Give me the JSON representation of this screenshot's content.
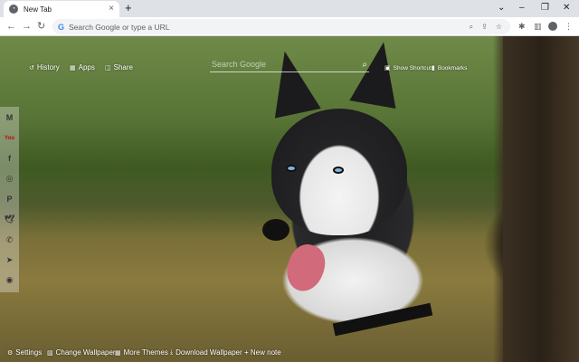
{
  "browser": {
    "tab_title": "New Tab",
    "tab_close": "×",
    "new_tab": "+",
    "omnibox_placeholder": "Search Google or type a URL",
    "window_controls": {
      "minimize": "–",
      "restore": "❐",
      "close": "✕",
      "menu": "⌄"
    }
  },
  "overlay": {
    "history_label": "History",
    "apps_label": "Apps",
    "share_label": "Share",
    "search_placeholder": "Search Google",
    "show_shortcuts_label": "Show Shortcuts",
    "bookmarks_label": "Bookmarks"
  },
  "social": [
    {
      "name": "gmail-icon",
      "glyph": "M"
    },
    {
      "name": "youtube-icon",
      "glyph": "You"
    },
    {
      "name": "facebook-icon",
      "glyph": "f"
    },
    {
      "name": "instagram-icon",
      "glyph": "◎"
    },
    {
      "name": "pinterest-icon",
      "glyph": "P"
    },
    {
      "name": "twitter-icon",
      "glyph": "🕊"
    },
    {
      "name": "whatsapp-icon",
      "glyph": "✆"
    },
    {
      "name": "telegram-icon",
      "glyph": "➤"
    },
    {
      "name": "reddit-icon",
      "glyph": "◉"
    }
  ],
  "bottom": {
    "settings_label": "Settings",
    "change_wallpaper_label": "Change Wallpaper",
    "more_themes_label": "More Themes",
    "download_wallpaper_label": "Download Wallpaper",
    "new_note_label": "+ New note"
  },
  "colors": {
    "toolbar_bg": "#ffffff",
    "tabstrip_bg": "#dee1e6",
    "overlay_text": "#ffffff"
  }
}
